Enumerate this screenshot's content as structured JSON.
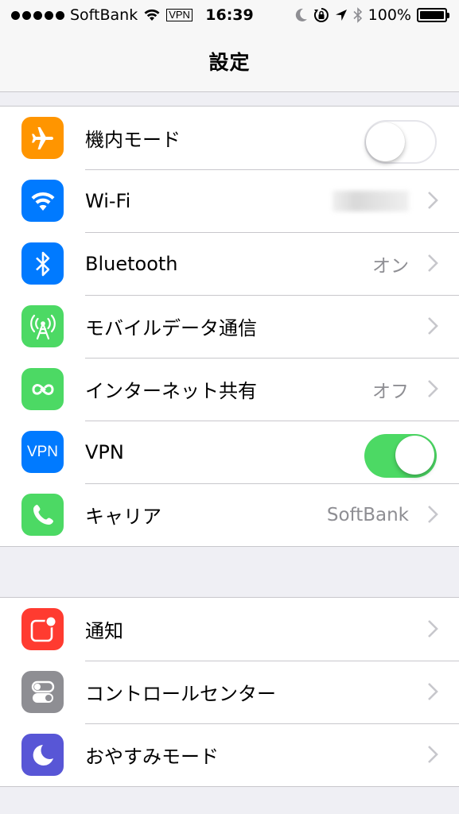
{
  "status_bar": {
    "carrier": "SoftBank",
    "vpn": "VPN",
    "time": "16:39",
    "battery": "100%",
    "signal_bars": 5
  },
  "nav": {
    "title": "設定"
  },
  "groups": [
    {
      "rows": [
        {
          "label": "機内モード",
          "icon": "airplane-icon",
          "icon_color": "#ff9500",
          "control": "toggle",
          "toggle_on": false
        },
        {
          "label": "Wi-Fi",
          "icon": "wifi-icon",
          "icon_color": "#007aff",
          "control": "chevron",
          "detail": "",
          "detail_obscured": true
        },
        {
          "label": "Bluetooth",
          "icon": "bluetooth-icon",
          "icon_color": "#007aff",
          "control": "chevron",
          "detail": "オン"
        },
        {
          "label": "モバイルデータ通信",
          "icon": "antenna-icon",
          "icon_color": "#4cd964",
          "control": "chevron",
          "detail": ""
        },
        {
          "label": "インターネット共有",
          "icon": "link-icon",
          "icon_color": "#4cd964",
          "control": "chevron",
          "detail": "オフ"
        },
        {
          "label": "VPN",
          "icon": "vpn-icon",
          "icon_text": "VPN",
          "icon_color": "#007aff",
          "control": "toggle",
          "toggle_on": true
        },
        {
          "label": "キャリア",
          "icon": "phone-icon",
          "icon_color": "#4cd964",
          "control": "chevron",
          "detail": "SoftBank"
        }
      ]
    },
    {
      "rows": [
        {
          "label": "通知",
          "icon": "notifications-icon",
          "icon_color": "#ff3b30",
          "control": "chevron"
        },
        {
          "label": "コントロールセンター",
          "icon": "switches-icon",
          "icon_color": "#8e8e93",
          "control": "chevron"
        },
        {
          "label": "おやすみモード",
          "icon": "moon-icon",
          "icon_color": "#5856d6",
          "control": "chevron"
        }
      ]
    }
  ],
  "colors": {
    "toggle_on": "#4cd964",
    "chevron": "#c7c7cc",
    "separator": "#c8c7cc"
  }
}
